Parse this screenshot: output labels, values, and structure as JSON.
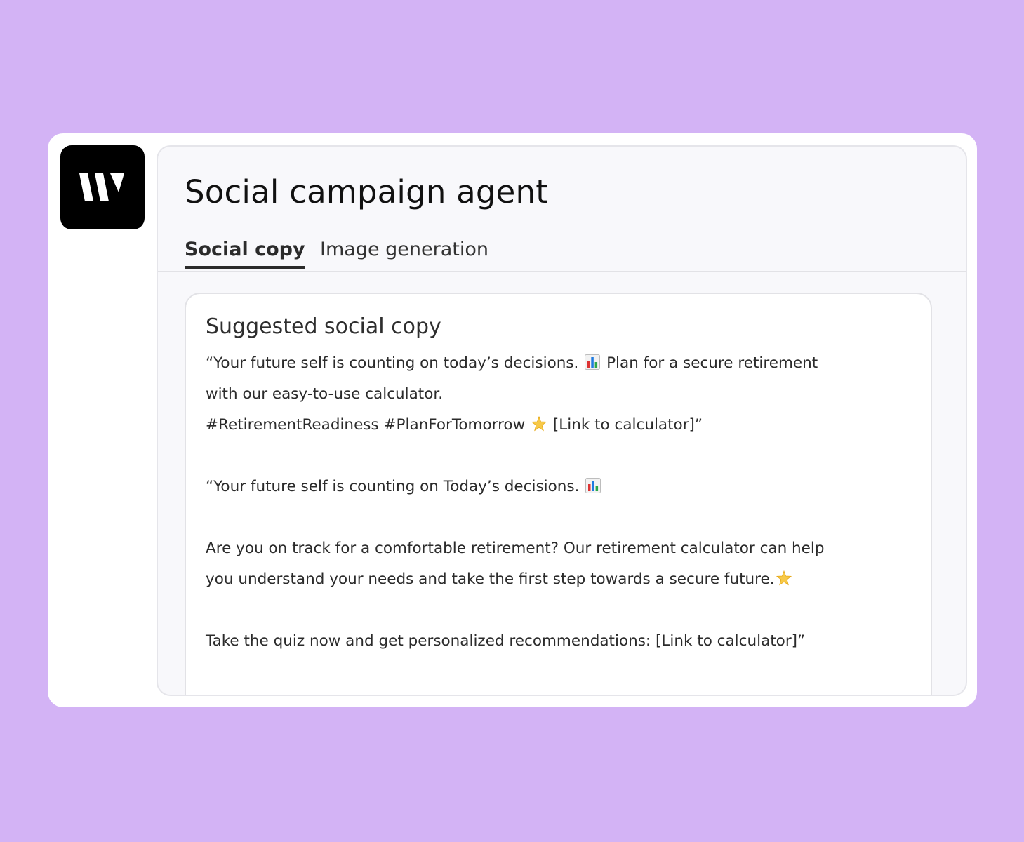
{
  "app": {
    "logo_icon": "w-logo-icon"
  },
  "header": {
    "title": "Social campaign agent"
  },
  "tabs": [
    {
      "label": "Social copy",
      "active": true
    },
    {
      "label": "Image generation",
      "active": false
    }
  ],
  "card": {
    "heading": "Suggested social copy",
    "option1": {
      "line1a": "“Your future self is counting on today’s decisions.",
      "line1b": "Plan for a secure retirement",
      "line2": "with our easy-to-use calculator.",
      "line3a": "#RetirementReadiness #PlanForTomorrow",
      "line3b": "[Link to calculator]”"
    },
    "option2": {
      "line1": "“Your future self is counting on Today’s decisions.",
      "para2_line1": "Are you on track for a comfortable retirement? Our retirement calculator can help",
      "para2_line2": "you understand your needs and take the first step towards a secure future.",
      "para3": "Take the quiz now and get personalized recommendations: [Link to calculator]”"
    }
  },
  "colors": {
    "background": "#d3b3f5",
    "logo_bg": "#000000",
    "panel_bg": "#f8f8fb"
  }
}
